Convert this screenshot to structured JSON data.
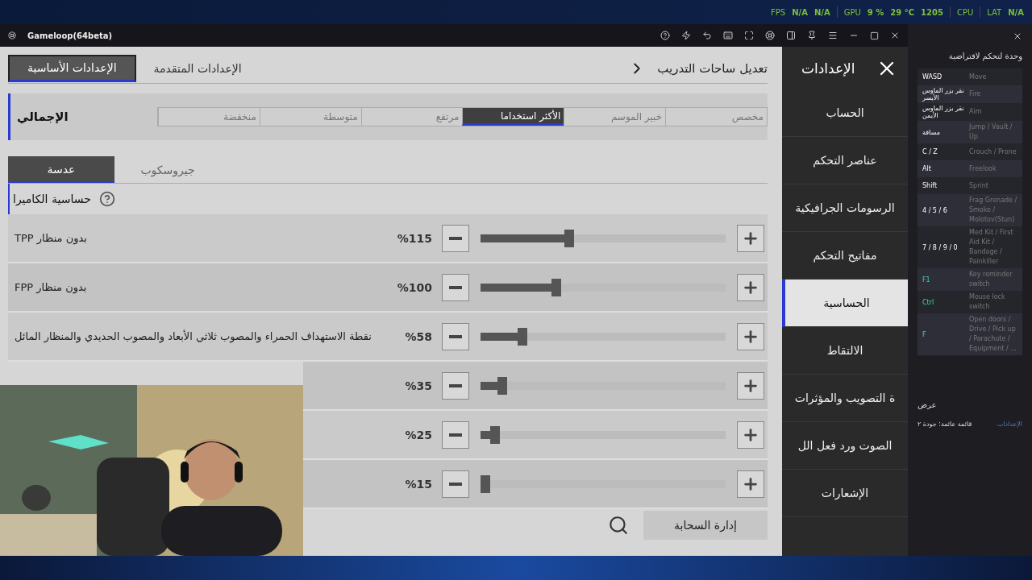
{
  "status_bar": {
    "fps_label": "FPS",
    "fps_value": "N/A",
    "fps_low": "N/A",
    "gpu_label": "GPU",
    "gpu_load": "9 %",
    "gpu_temp": "29 °C",
    "gpu_rpm": "1205",
    "cpu_label": "CPU",
    "lat_label": "LAT",
    "lat": "N/A"
  },
  "window": {
    "title": "Gameloop(64beta)"
  },
  "settings": {
    "title": "الإعدادات",
    "nav": [
      {
        "label": "الحساب",
        "selected": false
      },
      {
        "label": "عناصر التحكم",
        "selected": false
      },
      {
        "label": "الرسومات الجرافيكية",
        "selected": false
      },
      {
        "label": "مفاتيح التحكم",
        "selected": false
      },
      {
        "label": "الحساسية",
        "selected": true
      },
      {
        "label": "الالتقاط",
        "selected": false
      },
      {
        "label": "ة التصويب والمؤثرات",
        "selected": false
      },
      {
        "label": "الصوت ورد فعل الل",
        "selected": false
      },
      {
        "label": "الإشعارات",
        "selected": false
      }
    ],
    "top_tabs": [
      {
        "label": "الإعدادات المتقدمة",
        "selected": false
      },
      {
        "label": "الإعدادات الأساسية",
        "selected": true
      }
    ],
    "back_label": "تعديل ساحات التدريب",
    "preset_label": "الإجمالي",
    "presets": [
      {
        "label": "مخصص",
        "selected": false
      },
      {
        "label": "خبير الموسم",
        "selected": false
      },
      {
        "label": "الأكثر استخداما",
        "selected": true
      },
      {
        "label": "مرتفع",
        "selected": false
      },
      {
        "label": "متوسطة",
        "selected": false
      },
      {
        "label": "منخفضة",
        "selected": false
      }
    ],
    "sub_tabs": [
      {
        "label": "جيروسكوب",
        "selected": false
      },
      {
        "label": "عدسة",
        "selected": true
      }
    ],
    "section_title": "حساسية الكاميرا",
    "sliders": [
      {
        "label": "بدون منظار TPP",
        "reading": "%115",
        "level": 0.38
      },
      {
        "label": "بدون منظار FPP",
        "reading": "%100",
        "level": 0.33
      },
      {
        "label": "نقطة الاستهداف الحمراء والمصوب ثلاثي الأبعاد والمصوب الحديدي والمنظار المائل",
        "reading": "%58",
        "level": 0.19
      },
      {
        "reading": "%35",
        "level": 0.11
      },
      {
        "reading": "%25",
        "level": 0.08
      },
      {
        "reading": "%15",
        "level": 0.04
      }
    ],
    "cloud_button": "إدارة السحابة"
  },
  "keymap": {
    "title": "وحدة لتحكم لافتراضية",
    "rows": [
      {
        "key": "WASD",
        "action": "Move",
        "highlighted": false
      },
      {
        "key": "نقر بزر الماوس الأيسر",
        "action": "Fire",
        "highlighted": false
      },
      {
        "key": "نقر بزر الماوس الأيمن",
        "action": "Aim",
        "highlighted": false
      },
      {
        "key": "مسافة",
        "action": "Jump / Vault / Up",
        "highlighted": false
      },
      {
        "key": "C / Z",
        "action": "Crouch / Prone",
        "highlighted": false
      },
      {
        "key": "Alt",
        "action": "Freelook",
        "highlighted": false
      },
      {
        "key": "Shift",
        "action": "Sprint",
        "highlighted": false
      },
      {
        "key": "4 / 5 / 6",
        "action": "Frag Grenade / Smoke / Molotov(Stun)",
        "highlighted": false
      },
      {
        "key": "7 / 8 / 9 / 0",
        "action": "Med Kit / First Aid Kit / Bandage / Painkiller",
        "highlighted": false
      },
      {
        "key": "F1",
        "action": "Key reminder switch",
        "highlighted": true
      },
      {
        "key": "Ctrl",
        "action": "Mouse lock switch",
        "highlighted": true
      },
      {
        "key": "F",
        "action": "Open doors / Drive / Pick up / Parachute / Equipment / ...",
        "highlighted": true
      }
    ],
    "display_label": "عرض",
    "floating_menu": "قائمة عائمة: جودة ٢",
    "settings_link": "الإعدادات"
  }
}
